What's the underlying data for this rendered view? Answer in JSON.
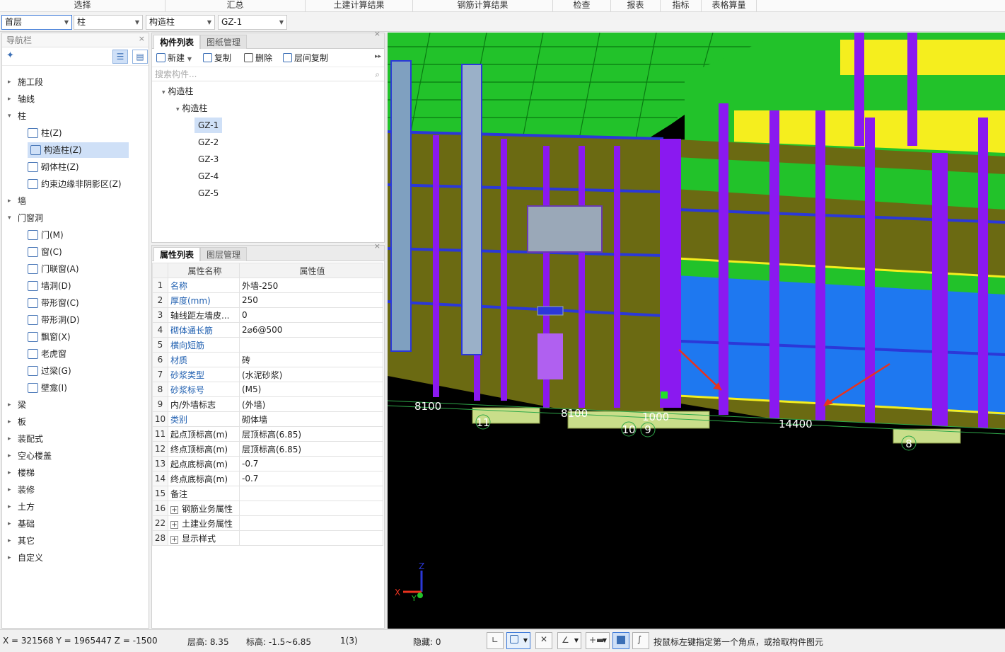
{
  "ribbon": {
    "groups": [
      "选择",
      "汇总",
      "土建计算结果",
      "钢筋计算结果",
      "检查",
      "报表",
      "指标",
      "表格算量"
    ]
  },
  "combos": {
    "floor": "首层",
    "category": "柱",
    "subtype": "构造柱",
    "component": "GZ-1"
  },
  "nav": {
    "title": "导航栏",
    "items": [
      {
        "label": "施工段",
        "kind": "group"
      },
      {
        "label": "轴线",
        "kind": "group"
      },
      {
        "label": "柱",
        "kind": "group-open"
      },
      {
        "label": "柱(Z)",
        "kind": "child"
      },
      {
        "label": "构造柱(Z)",
        "kind": "child",
        "selected": true
      },
      {
        "label": "砌体柱(Z)",
        "kind": "child"
      },
      {
        "label": "约束边缘非阴影区(Z)",
        "kind": "child"
      },
      {
        "label": "墙",
        "kind": "group"
      },
      {
        "label": "门窗洞",
        "kind": "group-open"
      },
      {
        "label": "门(M)",
        "kind": "child"
      },
      {
        "label": "窗(C)",
        "kind": "child"
      },
      {
        "label": "门联窗(A)",
        "kind": "child"
      },
      {
        "label": "墙洞(D)",
        "kind": "child"
      },
      {
        "label": "带形窗(C)",
        "kind": "child"
      },
      {
        "label": "带形洞(D)",
        "kind": "child"
      },
      {
        "label": "飘窗(X)",
        "kind": "child"
      },
      {
        "label": "老虎窗",
        "kind": "child"
      },
      {
        "label": "过梁(G)",
        "kind": "child"
      },
      {
        "label": "壁龛(I)",
        "kind": "child"
      },
      {
        "label": "梁",
        "kind": "group"
      },
      {
        "label": "板",
        "kind": "group"
      },
      {
        "label": "装配式",
        "kind": "group"
      },
      {
        "label": "空心楼盖",
        "kind": "group"
      },
      {
        "label": "楼梯",
        "kind": "group"
      },
      {
        "label": "装修",
        "kind": "group"
      },
      {
        "label": "土方",
        "kind": "group"
      },
      {
        "label": "基础",
        "kind": "group"
      },
      {
        "label": "其它",
        "kind": "group"
      },
      {
        "label": "自定义",
        "kind": "group"
      }
    ]
  },
  "component_panel": {
    "tabs": [
      "构件列表",
      "图纸管理"
    ],
    "toolbar": {
      "new": "新建",
      "copy": "复制",
      "delete": "删除",
      "floor_copy": "层间复制"
    },
    "search_placeholder": "搜索构件...",
    "tree": {
      "root": "构造柱",
      "group": "构造柱",
      "items": [
        "GZ-1",
        "GZ-2",
        "GZ-3",
        "GZ-4",
        "GZ-5"
      ],
      "selected": "GZ-1"
    }
  },
  "property_panel": {
    "tabs": [
      "属性列表",
      "图层管理"
    ],
    "header": {
      "name": "属性名称",
      "value": "属性值"
    },
    "rows": [
      {
        "no": "1",
        "name": "名称",
        "value": "外墙-250",
        "blue": true
      },
      {
        "no": "2",
        "name": "厚度(mm)",
        "value": "250",
        "blue": true
      },
      {
        "no": "3",
        "name": "轴线距左墙皮...",
        "value": "0",
        "blue": false
      },
      {
        "no": "4",
        "name": "砌体通长筋",
        "value": "2⌀6@500",
        "blue": true
      },
      {
        "no": "5",
        "name": "横向短筋",
        "value": "",
        "blue": true
      },
      {
        "no": "6",
        "name": "材质",
        "value": "砖",
        "blue": true
      },
      {
        "no": "7",
        "name": "砂浆类型",
        "value": "(水泥砂浆)",
        "blue": true
      },
      {
        "no": "8",
        "name": "砂浆标号",
        "value": "(M5)",
        "blue": true
      },
      {
        "no": "9",
        "name": "内/外墙标志",
        "value": "(外墙)",
        "blue": false
      },
      {
        "no": "10",
        "name": "类别",
        "value": "砌体墙",
        "blue": true
      },
      {
        "no": "11",
        "name": "起点顶标高(m)",
        "value": "层顶标高(6.85)",
        "blue": false
      },
      {
        "no": "12",
        "name": "终点顶标高(m)",
        "value": "层顶标高(6.85)",
        "blue": false
      },
      {
        "no": "13",
        "name": "起点底标高(m)",
        "value": "-0.7",
        "blue": false
      },
      {
        "no": "14",
        "name": "终点底标高(m)",
        "value": "-0.7",
        "blue": false
      },
      {
        "no": "15",
        "name": "备注",
        "value": "",
        "blue": false
      }
    ],
    "groups": [
      {
        "no": "16",
        "name": "钢筋业务属性"
      },
      {
        "no": "22",
        "name": "土建业务属性"
      },
      {
        "no": "28",
        "name": "显示样式"
      }
    ]
  },
  "viewport": {
    "dims": [
      "8100",
      "8100",
      "1000",
      "14400"
    ],
    "axes": [
      "11",
      "10",
      "9",
      "8"
    ],
    "axis_labels": {
      "x": "X",
      "y": "Y",
      "z": "Z"
    }
  },
  "status": {
    "coords": "X = 321568 Y = 1965447 Z = -1500",
    "floor_height": "层高:  8.35",
    "elevation": "标高:  -1.5~6.85",
    "count": "1(3)",
    "hidden": "隐藏:  0",
    "hint": "按鼠标左键指定第一个角点，或拾取构件图元"
  }
}
